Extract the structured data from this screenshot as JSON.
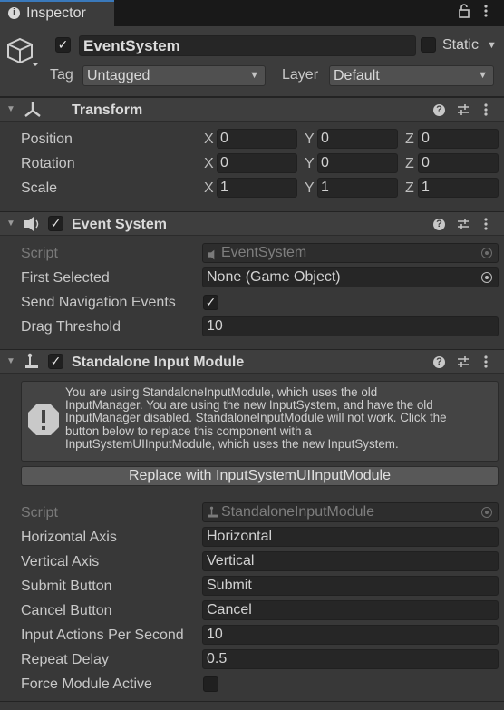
{
  "tab": {
    "label": "Inspector"
  },
  "gameobject": {
    "name": "EventSystem",
    "static_label": "Static",
    "tag_label": "Tag",
    "tag_value": "Untagged",
    "layer_label": "Layer",
    "layer_value": "Default"
  },
  "transform": {
    "title": "Transform",
    "rows": [
      {
        "label": "Position",
        "x": "0",
        "y": "0",
        "z": "0"
      },
      {
        "label": "Rotation",
        "x": "0",
        "y": "0",
        "z": "0"
      },
      {
        "label": "Scale",
        "x": "1",
        "y": "1",
        "z": "1"
      }
    ],
    "axis_x": "X",
    "axis_y": "Y",
    "axis_z": "Z"
  },
  "event_system": {
    "title": "Event System",
    "script_label": "Script",
    "script_value": "EventSystem",
    "first_selected_label": "First Selected",
    "first_selected_value": "None (Game Object)",
    "send_nav_label": "Send Navigation Events",
    "drag_threshold_label": "Drag Threshold",
    "drag_threshold_value": "10"
  },
  "input_module": {
    "title": "Standalone Input Module",
    "help_lines": [
      "You are using StandaloneInputModule, which uses the old",
      "InputManager. You are using the new InputSystem, and have the old",
      "InputManager disabled. StandaloneInputModule will not work. Click the",
      "button below to replace this component with a",
      "InputSystemUIInputModule, which uses the new InputSystem."
    ],
    "replace_button": "Replace with InputSystemUIInputModule",
    "script_label": "Script",
    "script_value": "StandaloneInputModule",
    "horizontal_axis_label": "Horizontal Axis",
    "horizontal_axis_value": "Horizontal",
    "vertical_axis_label": "Vertical Axis",
    "vertical_axis_value": "Vertical",
    "submit_label": "Submit Button",
    "submit_value": "Submit",
    "cancel_label": "Cancel Button",
    "cancel_value": "Cancel",
    "actions_label": "Input Actions Per Second",
    "actions_value": "10",
    "repeat_label": "Repeat Delay",
    "repeat_value": "0.5",
    "force_label": "Force Module Active"
  },
  "colors": {
    "background": "#383838",
    "field": "#262626",
    "tab_accent": "#3a79bb",
    "warning_icon": "#c9c9c9"
  }
}
